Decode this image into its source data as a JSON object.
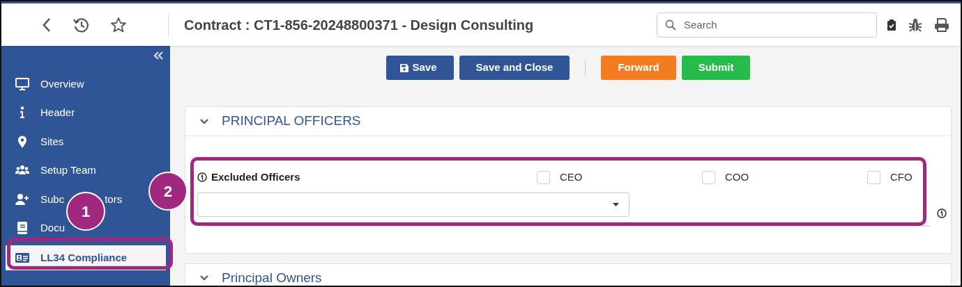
{
  "toolbar": {
    "title": "Contract : CT1-856-20248800371 - Design Consulting",
    "search": {
      "placeholder": "Search"
    }
  },
  "sidebar": {
    "items": [
      {
        "label": "Overview",
        "selected": false
      },
      {
        "label": "Header",
        "selected": false
      },
      {
        "label": "Sites",
        "selected": false
      },
      {
        "label": "Setup Team",
        "selected": false
      },
      {
        "label": "Subc",
        "label_end": "tors",
        "selected": false
      },
      {
        "label": "Docu",
        "selected": false
      },
      {
        "label": "LL34 Compliance",
        "selected": true
      }
    ]
  },
  "buttons": [
    {
      "label": "Save",
      "kind": "primary"
    },
    {
      "label": "Save and Close",
      "kind": "primary"
    },
    {
      "label": "Forward",
      "kind": "warning"
    },
    {
      "label": "Submit",
      "kind": "success"
    }
  ],
  "sections": [
    {
      "title": "PRINCIPAL OFFICERS",
      "expanded": true,
      "field": {
        "label": "Excluded Officers",
        "options": [
          {
            "label": "CEO",
            "checked": false
          },
          {
            "label": "COO",
            "checked": false
          },
          {
            "label": "CFO",
            "checked": false
          }
        ]
      }
    },
    {
      "title": "Principal Owners",
      "expanded": true
    }
  ],
  "callouts": [
    {
      "number": "1"
    },
    {
      "number": "2"
    }
  ]
}
